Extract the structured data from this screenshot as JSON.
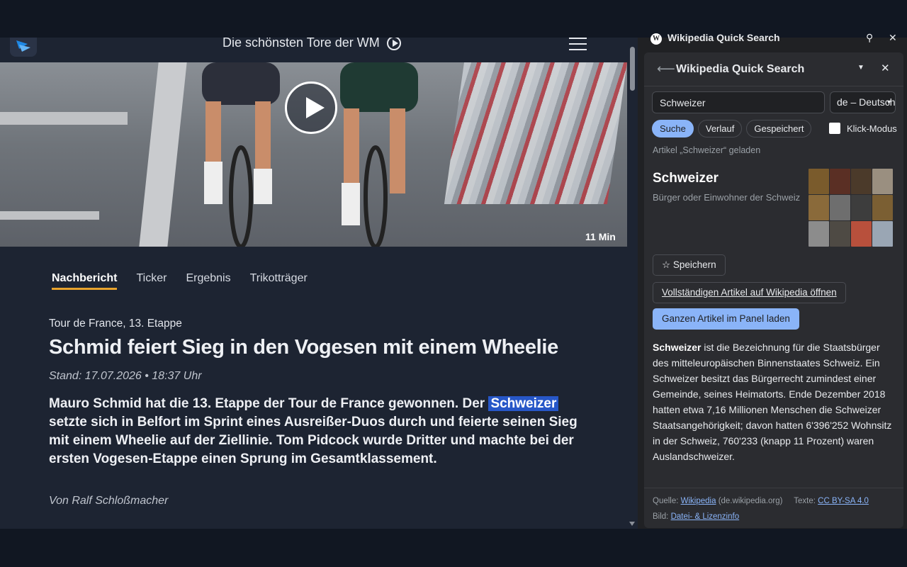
{
  "site": {
    "promo_text": "Die schönsten Tore der WM",
    "video": {
      "duration": "11 Min"
    },
    "tabs": [
      {
        "label": "Nachbericht",
        "active": true
      },
      {
        "label": "Ticker",
        "active": false
      },
      {
        "label": "Ergebnis",
        "active": false
      },
      {
        "label": "Trikotträger",
        "active": false
      }
    ],
    "kicker": "Tour de France, 13. Etappe",
    "headline": "Schmid feiert Sieg in den Vogesen mit einem Wheelie",
    "stand": "Stand: 17.07.2026 • 18:37 Uhr",
    "lead_before": "Mauro Schmid hat die 13. Etappe der Tour de France gewonnen. Der ",
    "lead_highlight": "Schweizer",
    "lead_after": " setzte sich in Belfort im Sprint eines Ausreißer-Duos durch und feierte seinen Sieg mit einem Wheelie auf der Ziellinie. Tom Pidcock wurde Dritter und machte bei der ersten Vogesen-Etappe einen Sprung im Gesamtklassement.",
    "author": "Von Ralf Schloßmacher",
    "accent_color": "#e8a32c",
    "highlight_color": "#2757c8"
  },
  "panel": {
    "window_title": "Wikipedia Quick Search",
    "window_icon_letter": "W",
    "title": "Wikipedia Quick Search",
    "search_value": "Schweizer",
    "language": "de – Deutsch",
    "chips": [
      {
        "label": "Suche",
        "active": true
      },
      {
        "label": "Verlauf",
        "active": false
      },
      {
        "label": "Gespeichert",
        "active": false
      }
    ],
    "click_mode_label": "Klick-Modus",
    "status": "Artikel „Schweizer“ geladen",
    "article_title": "Schweizer",
    "article_subtitle": "Bürger oder Einwohner der Schweiz",
    "save_button": "☆ Speichern",
    "open_button": "Vollständigen Artikel auf Wikipedia öffnen",
    "load_button": "Ganzen Artikel im Panel laden",
    "extract_bold": "Schweizer",
    "extract_rest": " ist die Bezeichnung für die Staatsbürger des mitteleuropäischen Binnenstaates Schweiz. Ein Schweizer besitzt das Bürgerrecht zumindest einer Gemeinde, seines Heimatorts. Ende Dezember 2018 hatten etwa 7,16 Millionen Menschen die Schweizer Staatsangehörigkeit; davon hatten 6'396'252 Wohnsitz in der Schweiz, 760'233 (knapp 11 Prozent) waren Auslandschweizer.",
    "footer": {
      "source_label": "Quelle:",
      "source_link": "Wikipedia",
      "source_domain": "(de.wikipedia.org)",
      "text_label": "Texte:",
      "license_link": "CC BY-SA 4.0",
      "image_label": "Bild:",
      "image_link": "Datei- & Lizenzinfo"
    },
    "accent_color": "#8ab4f8"
  }
}
